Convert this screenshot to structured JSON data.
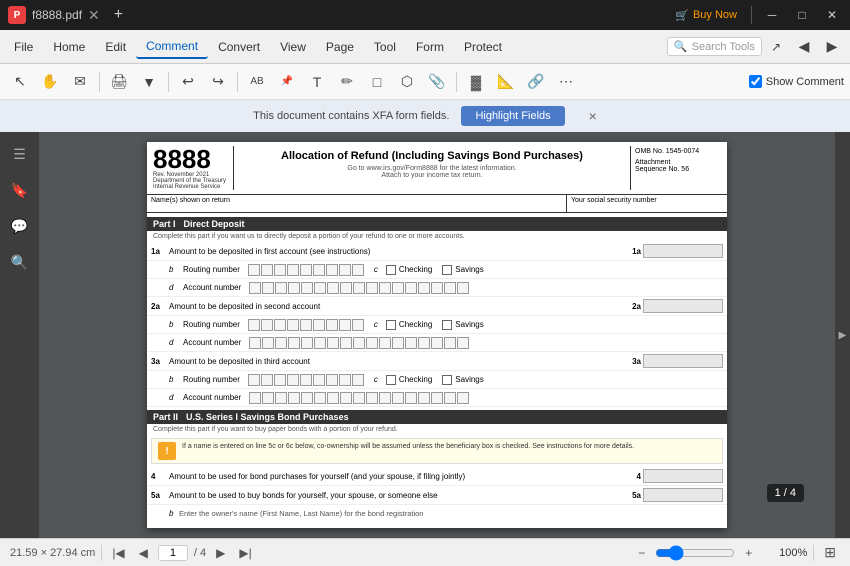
{
  "titlebar": {
    "filename": "f8888.pdf",
    "buy_now": "Buy Now",
    "logo": "P"
  },
  "menubar": {
    "items": [
      "File",
      "Home",
      "Edit",
      "Comment",
      "Convert",
      "View",
      "Page",
      "Tool",
      "Form",
      "Protect"
    ],
    "active_item": "Comment",
    "search_placeholder": "Search Tools"
  },
  "toolbar": {
    "show_comment_label": "Show Comment"
  },
  "xfa_bar": {
    "notice": "This document contains XFA form fields.",
    "button": "Highlight Fields",
    "close_icon": "×"
  },
  "left_panel": {
    "icons": [
      "☰",
      "🔖",
      "💬",
      "🔍"
    ]
  },
  "pdf": {
    "form_number": "8888",
    "form_rev": "Rev. November 2021",
    "form_dept": "Department of the Treasury",
    "form_irs": "Internal Revenue Service",
    "title": "Allocation of Refund (Including Savings Bond Purchases)",
    "goto_text": "Go to www.irs.gov/Form8888 for the latest information.",
    "attach_text": "Attach to your income tax return.",
    "omb": "OMB No. 1545-0074",
    "attachment": "Attachment",
    "sequence": "Sequence No. 56",
    "name_label": "Name(s) shown on return",
    "ssn_label": "Your social security number",
    "part1_label": "Part I",
    "part1_title": "Direct Deposit",
    "part1_desc": "Complete this part if you want us to directly deposit a portion of your refund to one or more accounts.",
    "rows": [
      {
        "num": "1a",
        "label": "Amount to be deposited in first account (see instructions)",
        "has_boxes": false,
        "has_amount": true
      },
      {
        "num": "b",
        "label": "Routing number",
        "has_boxes": true,
        "box_count": 9,
        "mid_letter": "c",
        "has_checkboxes": true
      },
      {
        "num": "d",
        "label": "Account number",
        "has_boxes": true,
        "box_count": 17
      },
      {
        "num": "2a",
        "label": "Amount to be deposited in second account",
        "has_boxes": false,
        "has_amount": true
      },
      {
        "num": "b",
        "label": "Routing number",
        "has_boxes": true,
        "box_count": 9,
        "mid_letter": "c",
        "has_checkboxes": true
      },
      {
        "num": "d",
        "label": "Account number",
        "has_boxes": true,
        "box_count": 17
      },
      {
        "num": "3a",
        "label": "Amount to be deposited in third account",
        "has_boxes": false,
        "has_amount": true
      },
      {
        "num": "b",
        "label": "Routing number",
        "has_boxes": true,
        "box_count": 9,
        "mid_letter": "c",
        "has_checkboxes": true
      },
      {
        "num": "d",
        "label": "Account number",
        "has_boxes": true,
        "box_count": 17
      }
    ],
    "part2_label": "Part II",
    "part2_title": "U.S. Series I Savings Bond Purchases",
    "part2_desc": "Complete this part if you want to buy paper bonds with a portion of your refund.",
    "warning_text": "If a name is entered on line 5c or 6c below, co-ownership will be assumed unless the beneficiary box is checked. See instructions for more details.",
    "row4_label": "Amount to be used for bond purchases for yourself (and your spouse, if filing jointly)",
    "row4_num": "4",
    "row5a_num": "5a",
    "row5a_label": "Amount to be used to buy bonds for yourself, your spouse, or someone else",
    "row5b_label": "Enter the owner's name (First Name, Last Name) for the bond registration",
    "checking_label": "Checking",
    "savings_label": "Savings"
  },
  "bottom_bar": {
    "page_current": "1",
    "page_total": "/ 4",
    "page_size": "21.59 × 27.94 cm",
    "zoom_level": "100%",
    "badge_text": "1 / 4"
  }
}
